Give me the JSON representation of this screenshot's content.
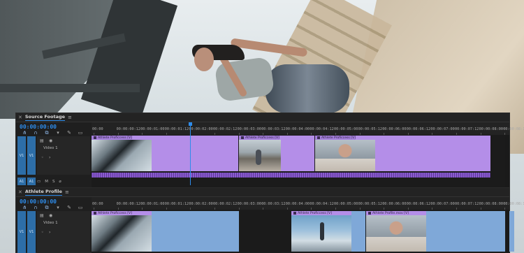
{
  "panels": [
    {
      "title": "Source Footage",
      "timecode": "00:00:00:00",
      "video_track_name": "Video 1",
      "track_targets": {
        "v_left": "V1",
        "v_right": "V1",
        "a_left": "A1",
        "a_right": "A1"
      },
      "clips": [
        {
          "label": "Athlete Proficcess [V]"
        },
        {
          "label": "Athlete Proficcess [V]"
        },
        {
          "label": "Athlete Proficcess [V]"
        }
      ]
    },
    {
      "title": "Athlete Profile",
      "timecode": "00:00:00:00",
      "video_track_name": "Video 1",
      "track_targets": {
        "v_left": "V1",
        "v_right": "V1",
        "a_left": "A1",
        "a_right": "A1"
      },
      "clips": [
        {
          "label": "Athlete Proficcess [V]"
        },
        {
          "label": "Athlete Proficcess [V]"
        },
        {
          "label": "Athlete Profile.mov [V]"
        }
      ]
    }
  ],
  "ruler_ticks": [
    "00:00",
    "00:00:00:12",
    "00:00:01:00",
    "00:00:01:12",
    "00:00:02:00",
    "00:00:02:12",
    "00:00:03:00",
    "00:00:03:12",
    "00:00:04:00",
    "00:00:04:12",
    "00:00:05:00",
    "00:00:05:12",
    "00:00:06:00",
    "00:00:06:12",
    "00:00:07:00",
    "00:00:07:12",
    "00:00:08:00",
    "00:00:08:12"
  ],
  "icons": [
    "close-icon",
    "menu-icon",
    "snap-icon",
    "link-icon",
    "marker-icon",
    "wrench-icon",
    "captions-icon",
    "eye-icon",
    "lock-icon",
    "mute-icon",
    "solo-icon",
    "mic-icon",
    "toggle-sync-icon"
  ],
  "colors": {
    "accent": "#2d8ceb",
    "video_clip": "#b48ee8",
    "audio_clip": "#8a5ad0",
    "blue_clip": "#7fa8d8",
    "panel_bg": "#1f1f1f"
  }
}
